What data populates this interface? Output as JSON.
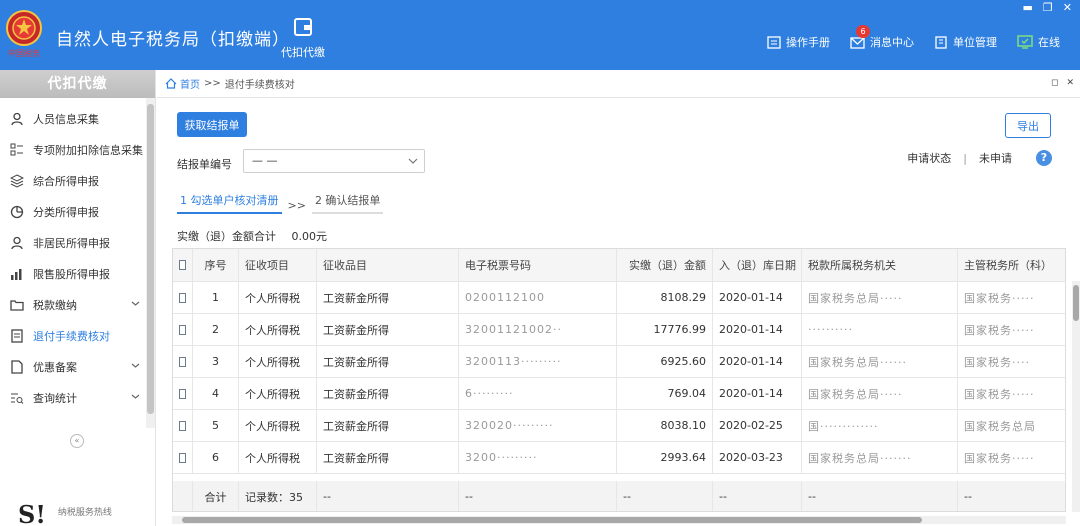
{
  "header": {
    "logo_text": "中国税务",
    "app_title": "自然人电子税务局（扣缴端）",
    "module_label": "代扣代缴",
    "links": {
      "manual": "操作手册",
      "messages": "消息中心",
      "messages_badge": "6",
      "unit": "单位管理",
      "online": "在线"
    }
  },
  "sidebar": {
    "title": "代扣代缴",
    "items": [
      {
        "label": "人员信息采集",
        "icon": "person-icon"
      },
      {
        "label": "专项附加扣除信息采集",
        "icon": "list-icon"
      },
      {
        "label": "综合所得申报",
        "icon": "layers-icon"
      },
      {
        "label": "分类所得申报",
        "icon": "pie-icon"
      },
      {
        "label": "非居民所得申报",
        "icon": "person-icon"
      },
      {
        "label": "限售股所得申报",
        "icon": "bar-chart-icon"
      },
      {
        "label": "税款缴纳",
        "icon": "folder-icon"
      },
      {
        "label": "退付手续费核对",
        "icon": "document-icon"
      },
      {
        "label": "优惠备案",
        "icon": "file-icon"
      },
      {
        "label": "查询统计",
        "icon": "search-list-icon"
      }
    ],
    "hotline_big": "S!",
    "hotline_text": "纳税服务热线"
  },
  "breadcrumb": {
    "home": "首页",
    "sep": ">>",
    "current": "退付手续费核对"
  },
  "toolbar": {
    "fetch_label": "获取结报单",
    "export_label": "导出"
  },
  "form": {
    "report_no_label": "结报单编号",
    "report_no_value": "— —",
    "status_label": "申请状态",
    "status_divider": "|",
    "status_value": "未申请",
    "help": "?"
  },
  "steps": {
    "step1": "1 勾选单户核对清册",
    "arrow": ">>",
    "step2": "2 确认结报单"
  },
  "summary": {
    "label": "实缴（退）金额合计",
    "value": "0.00元"
  },
  "table": {
    "headers": [
      "",
      "序号",
      "征收项目",
      "征收品目",
      "电子税票号码",
      "实缴（退）金额",
      "入（退）库日期",
      "税款所属税务机关",
      "主管税务所（科）"
    ],
    "rows": [
      {
        "no": "1",
        "item": "个人所得税",
        "sub": "工资薪金所得",
        "ticket": "0200112100",
        "amount": "8108.29",
        "date": "2020-01-14",
        "office": "国家税务总局·····",
        "sub_office": "国家税务·····"
      },
      {
        "no": "2",
        "item": "个人所得税",
        "sub": "工资薪金所得",
        "ticket": "32001121002··",
        "amount": "17776.99",
        "date": "2020-01-14",
        "office": "··········",
        "sub_office": "国家税务·····"
      },
      {
        "no": "3",
        "item": "个人所得税",
        "sub": "工资薪金所得",
        "ticket": "3200113·········",
        "amount": "6925.60",
        "date": "2020-01-14",
        "office": "国家税务总局······",
        "sub_office": "国家税务····"
      },
      {
        "no": "4",
        "item": "个人所得税",
        "sub": "工资薪金所得",
        "ticket": "6·········",
        "amount": "769.04",
        "date": "2020-01-14",
        "office": "国家税务总局·····",
        "sub_office": "国家税务·····"
      },
      {
        "no": "5",
        "item": "个人所得税",
        "sub": "工资薪金所得",
        "ticket": "320020·········",
        "amount": "8038.10",
        "date": "2020-02-25",
        "office": "国·············",
        "sub_office": "国家税务总局"
      },
      {
        "no": "6",
        "item": "个人所得税",
        "sub": "工资薪金所得",
        "ticket": "3200·········",
        "amount": "2993.64",
        "date": "2020-03-23",
        "office": "国家税务总局·······",
        "sub_office": "国家税务·····"
      }
    ],
    "footer": {
      "label": "合计",
      "count": "记录数：35",
      "dash": "--"
    }
  },
  "colors": {
    "primary": "#2f7fe0",
    "header_bg": "#2f7fe0",
    "sidebar_head": "#c4c4c4"
  }
}
